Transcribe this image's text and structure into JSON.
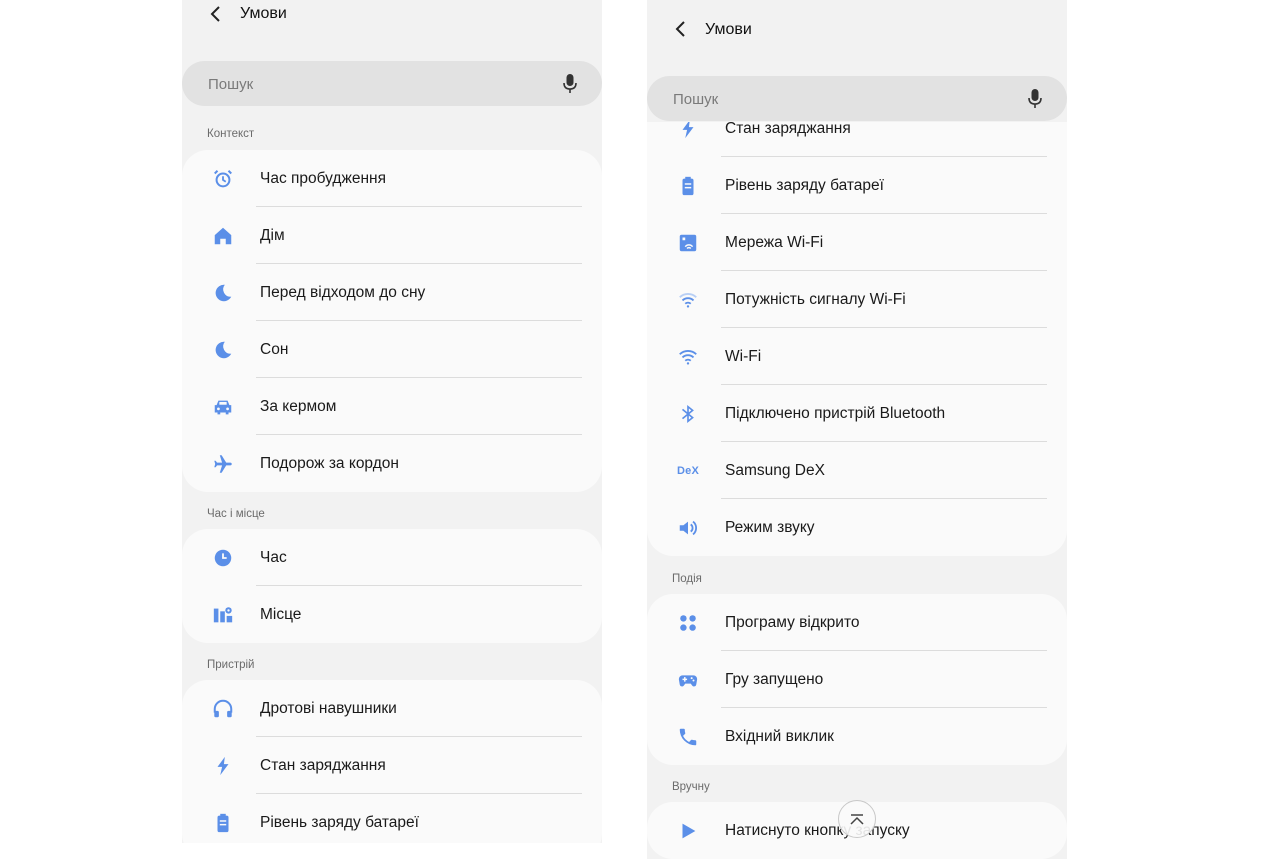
{
  "colors": {
    "accent": "#5b8fe8",
    "background": "#f2f2f2",
    "card": "#fafafa"
  },
  "left": {
    "title": "Умови",
    "search_placeholder": "Пошук",
    "sections": [
      {
        "title": "Контекст",
        "items": [
          {
            "label": "Час пробудження",
            "icon": "alarm-icon"
          },
          {
            "label": "Дім",
            "icon": "home-icon"
          },
          {
            "label": "Перед відходом до сну",
            "icon": "moon-icon"
          },
          {
            "label": "Сон",
            "icon": "moon-icon"
          },
          {
            "label": "За кермом",
            "icon": "car-icon"
          },
          {
            "label": "Подорож за кордон",
            "icon": "airplane-icon"
          }
        ]
      },
      {
        "title": "Час і місце",
        "items": [
          {
            "label": "Час",
            "icon": "clock-icon"
          },
          {
            "label": "Місце",
            "icon": "map-pin-icon"
          }
        ]
      },
      {
        "title": "Пристрій",
        "items": [
          {
            "label": "Дротові навушники",
            "icon": "headphones-icon"
          },
          {
            "label": "Стан заряджання",
            "icon": "bolt-icon"
          },
          {
            "label": "Рівень заряду батареї",
            "icon": "battery-icon"
          }
        ]
      }
    ]
  },
  "right": {
    "title": "Умови",
    "search_placeholder": "Пошук",
    "device_items": [
      {
        "label": "Стан заряджання",
        "icon": "bolt-icon"
      },
      {
        "label": "Рівень заряду батареї",
        "icon": "battery-icon"
      },
      {
        "label": "Мережа Wi-Fi",
        "icon": "wifi-network-icon"
      },
      {
        "label": "Потужність сигналу Wi-Fi",
        "icon": "wifi-signal-icon"
      },
      {
        "label": "Wi-Fi",
        "icon": "wifi-icon"
      },
      {
        "label": "Підключено пристрій Bluetooth",
        "icon": "bluetooth-icon"
      },
      {
        "label": "Samsung DeX",
        "icon": "dex-icon",
        "icon_text": "DeX"
      },
      {
        "label": "Режим звуку",
        "icon": "speaker-icon"
      }
    ],
    "events_title": "Подія",
    "events_items": [
      {
        "label": "Програму відкрито",
        "icon": "apps-icon"
      },
      {
        "label": "Гру запущено",
        "icon": "gamepad-icon"
      },
      {
        "label": "Вхідний виклик",
        "icon": "phone-icon"
      }
    ],
    "manual_title": "Вручну",
    "manual_items": [
      {
        "label": "Натиснуто кнопку запуску",
        "icon": "play-icon"
      }
    ]
  }
}
